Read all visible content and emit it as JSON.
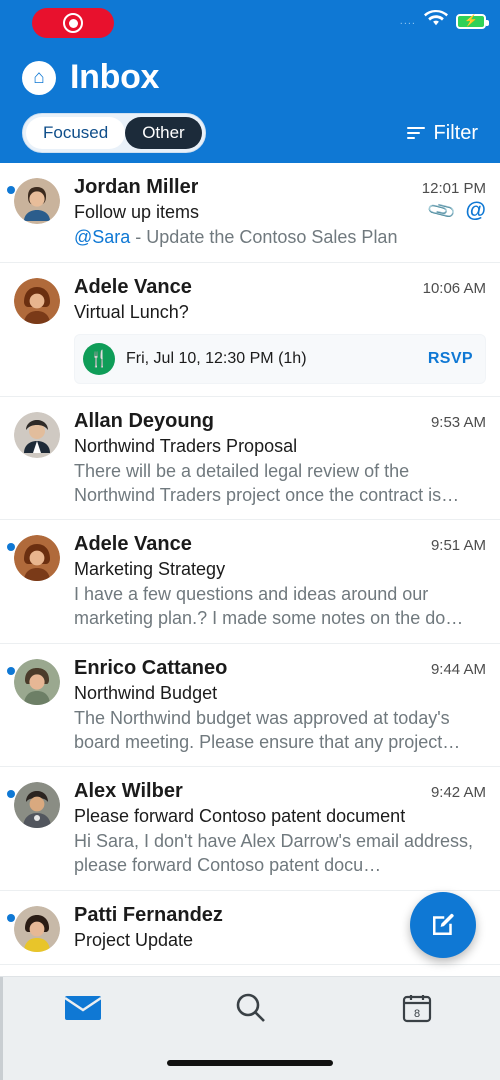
{
  "status": {
    "record_icon": "record-icon",
    "signal_dots": "....",
    "wifi_icon": "wifi-icon",
    "battery_icon": "battery-charging-icon",
    "battery_bolt": "⚡"
  },
  "header": {
    "home_icon": "home-icon",
    "title": "Inbox",
    "tabs": [
      {
        "label": "Focused",
        "state": "active"
      },
      {
        "label": "Other",
        "state": "selected-dark"
      }
    ],
    "filter": {
      "label": "Filter",
      "icon": "filter-icon"
    },
    "accent_color": "#0f78d4"
  },
  "messages": [
    {
      "unread": true,
      "sender": "Jordan Miller",
      "time": "12:01 PM",
      "subject": "Follow up items",
      "icons": [
        "attachment-icon",
        "mention-icon"
      ],
      "preview_mention": "@Sara",
      "preview": " - Update the Contoso Sales Plan",
      "avatar": "avatar-jordan-miller"
    },
    {
      "unread": false,
      "sender": "Adele Vance",
      "time": "10:06 AM",
      "subject": "Virtual Lunch?",
      "meeting": {
        "icon": "utensils-icon",
        "text": "Fri, Jul 10, 12:30 PM (1h)",
        "action": "RSVP"
      },
      "avatar": "avatar-adele-vance"
    },
    {
      "unread": false,
      "sender": "Allan Deyoung",
      "time": "9:53 AM",
      "subject": "Northwind Traders Proposal",
      "preview": "There will be a detailed legal review of the Northwind Traders project once the contract is…",
      "avatar": "avatar-allan-deyoung"
    },
    {
      "unread": true,
      "sender": "Adele Vance",
      "time": "9:51 AM",
      "subject": "Marketing Strategy",
      "preview": "I have a few questions and ideas around our marketing plan.? I made some notes on the do…",
      "avatar": "avatar-adele-vance-2"
    },
    {
      "unread": true,
      "sender": "Enrico Cattaneo",
      "time": "9:44 AM",
      "subject": "Northwind Budget",
      "preview": "The Northwind budget was approved at today's board meeting. Please ensure that any project…",
      "avatar": "avatar-enrico-cattaneo"
    },
    {
      "unread": true,
      "sender": "Alex Wilber",
      "time": "9:42 AM",
      "subject": "Please forward Contoso patent document",
      "preview": "Hi Sara, I don't have Alex Darrow's email address, please forward Contoso patent docu…",
      "avatar": "avatar-alex-wilber"
    },
    {
      "unread": true,
      "sender": "Patti Fernandez",
      "time": "",
      "subject": "Project Update",
      "preview": "",
      "avatar": "avatar-patti-fernandez"
    }
  ],
  "compose": {
    "icon": "compose-icon",
    "label": "Compose"
  },
  "bottom_nav": [
    {
      "name": "mail-tab",
      "icon": "mail-icon",
      "active": true
    },
    {
      "name": "search-tab",
      "icon": "search-icon",
      "active": false
    },
    {
      "name": "calendar-tab",
      "icon": "calendar-icon",
      "badge": "8",
      "active": false
    }
  ]
}
